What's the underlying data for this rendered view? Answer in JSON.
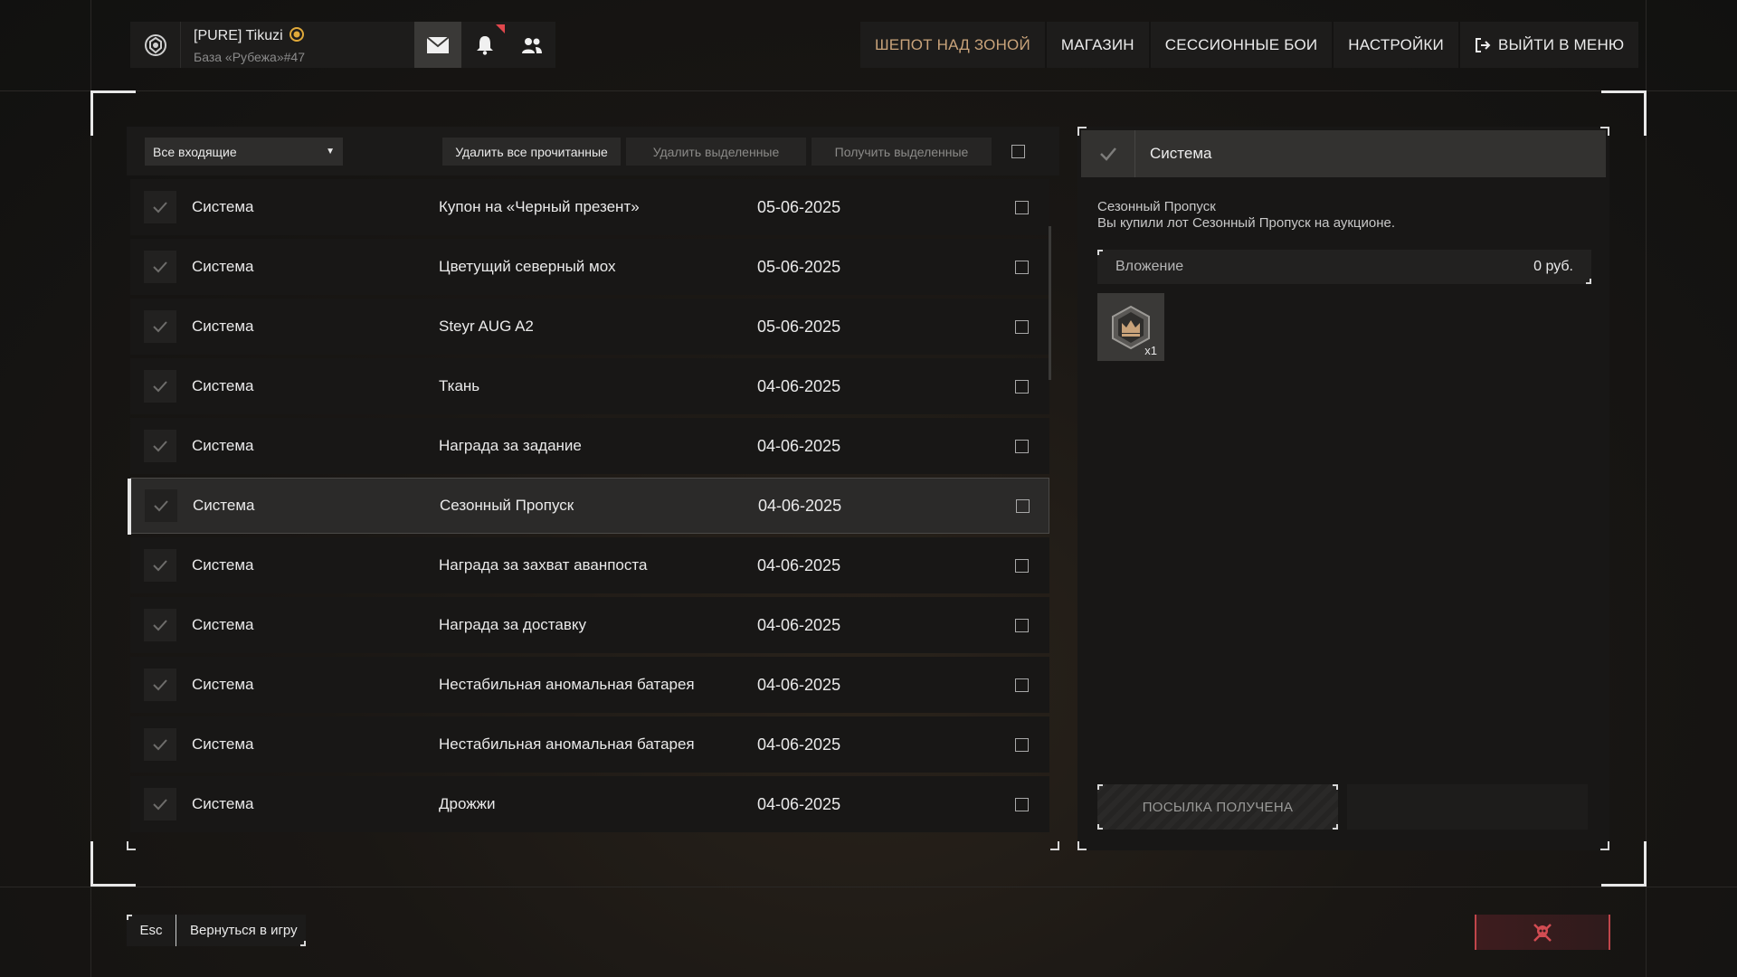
{
  "profile": {
    "name": "[PURE] Tikuzi",
    "base": "База «Рубежа»#47",
    "badge_color": "#e0a93a"
  },
  "top_icons": {
    "mail": "mail-icon",
    "bell": "bell-icon",
    "friends": "friends-icon",
    "notification_color": "#e0474c"
  },
  "nav": {
    "items": [
      "ШЕПОТ НАД ЗОНОЙ",
      "МАГАЗИН",
      "СЕССИОННЫЕ БОИ",
      "НАСТРОЙКИ"
    ],
    "exit": "ВЫЙТИ В МЕНЮ",
    "accent_color": "#c9a37a"
  },
  "toolbar": {
    "filter": "Все входящие",
    "delete_read": "Удалить все прочитанные",
    "delete_selected": "Удалить выделенные",
    "receive_selected": "Получить выделенные"
  },
  "messages": [
    {
      "sender": "Система",
      "subject": "Купон на «Черный презент»",
      "date": "05-06-2025",
      "selected": false
    },
    {
      "sender": "Система",
      "subject": "Цветущий северный мох",
      "date": "05-06-2025",
      "selected": false
    },
    {
      "sender": "Система",
      "subject": "Steyr AUG A2",
      "date": "05-06-2025",
      "selected": false
    },
    {
      "sender": "Система",
      "subject": "Ткань",
      "date": "04-06-2025",
      "selected": false
    },
    {
      "sender": "Система",
      "subject": "Награда за задание",
      "date": "04-06-2025",
      "selected": false
    },
    {
      "sender": "Система",
      "subject": "Сезонный Пропуск",
      "date": "04-06-2025",
      "selected": true
    },
    {
      "sender": "Система",
      "subject": "Награда за захват аванпоста",
      "date": "04-06-2025",
      "selected": false
    },
    {
      "sender": "Система",
      "subject": "Награда за доставку",
      "date": "04-06-2025",
      "selected": false
    },
    {
      "sender": "Система",
      "subject": "Нестабильная аномальная батарея",
      "date": "04-06-2025",
      "selected": false
    },
    {
      "sender": "Система",
      "subject": "Нестабильная аномальная батарея",
      "date": "04-06-2025",
      "selected": false
    },
    {
      "sender": "Система",
      "subject": "Дрожжи",
      "date": "04-06-2025",
      "selected": false
    }
  ],
  "detail": {
    "sender": "Система",
    "title": "Сезонный Пропуск",
    "body": "Вы купили лот Сезонный Пропуск на аукционе.",
    "attachment_label": "Вложение",
    "attachment_value": "0 руб.",
    "item_qty": "x1",
    "item_icon": "season-pass-icon",
    "received_button": "ПОСЫЛКА ПОЛУЧЕНА"
  },
  "bottom": {
    "esc_key": "Esc",
    "back_label": "Вернуться в игру",
    "danger_color": "#c0454a"
  }
}
